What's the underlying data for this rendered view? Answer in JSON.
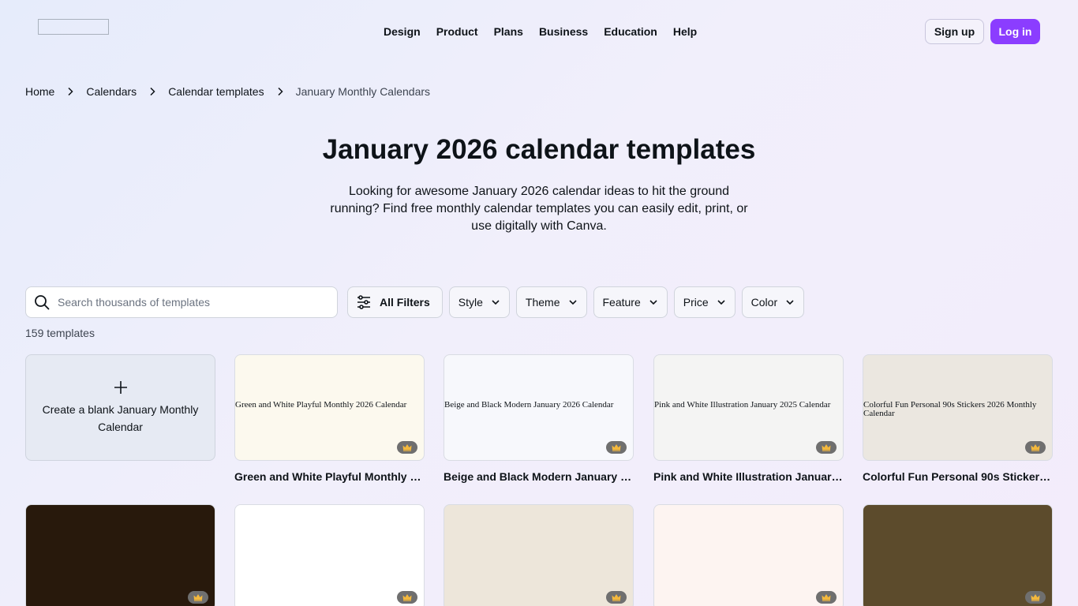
{
  "header": {
    "nav": [
      "Design",
      "Product",
      "Plans",
      "Business",
      "Education",
      "Help"
    ],
    "signup_label": "Sign up",
    "login_label": "Log in"
  },
  "breadcrumb": [
    "Home",
    "Calendars",
    "Calendar templates",
    "January Monthly Calendars"
  ],
  "page": {
    "title": "January 2026 calendar templates",
    "description": "Looking for awesome January 2026 calendar ideas to hit the ground running? Find free monthly calendar templates you can easily edit, print, or use digitally with Canva."
  },
  "search": {
    "placeholder": "Search thousands of templates"
  },
  "filters": {
    "all_label": "All Filters",
    "dropdowns": [
      "Style",
      "Theme",
      "Feature",
      "Price",
      "Color"
    ]
  },
  "results_count": "159 templates",
  "blank_card": {
    "label": "Create a blank January Monthly Calendar"
  },
  "templates_row1": [
    {
      "alt": "Green and White Playful Monthly 2026 Calendar",
      "title": "Green and White Playful Monthly 2026 Calendar",
      "bg": "#fcf9ee"
    },
    {
      "alt": "Beige and Black Modern January 2026 Calendar",
      "title": "Beige and Black Modern January 2026 Calendar",
      "bg": "#f7f8fc"
    },
    {
      "alt": "Pink and White Illustration January 2025 Calendar",
      "title": "Pink and White Illustration January 2025 Calendar",
      "bg": "#f4f4f3"
    },
    {
      "alt": "Colorful Fun Personal 90s Stickers 2026 Monthly Calendar",
      "title": "Colorful Fun Personal 90s Stickers 2026 Monthly Calendar",
      "bg": "#ebe7e0"
    }
  ],
  "templates_row2": [
    {
      "bg": "#28190c"
    },
    {
      "bg": "#ffffff"
    },
    {
      "bg": "#ede6da"
    },
    {
      "bg": "#fdf4f1"
    },
    {
      "bg": "#5c4b2c"
    }
  ],
  "colors": {
    "accent": "#8b3dff",
    "premium_badge": "#6f6f6f",
    "crown": "#f3b83d"
  },
  "icons": {
    "search": "search-icon",
    "filters": "sliders-icon",
    "dropdown": "chevron-down-icon",
    "separator": "chevron-right-icon",
    "premium": "crown-icon",
    "add": "plus-icon"
  }
}
